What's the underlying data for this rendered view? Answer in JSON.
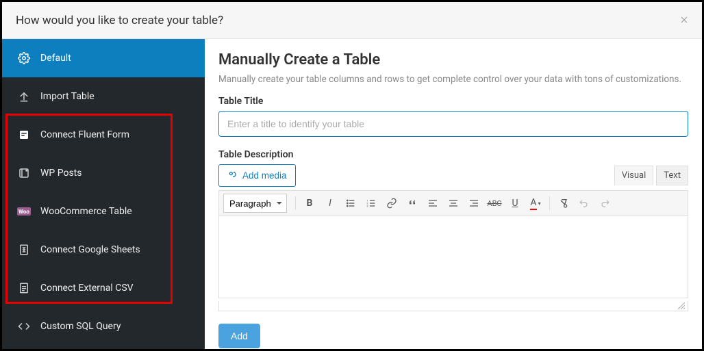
{
  "header": {
    "title": "How would you like to create your table?"
  },
  "sidebar": {
    "items": [
      {
        "label": "Default",
        "icon": "gear"
      },
      {
        "label": "Import Table",
        "icon": "upload"
      },
      {
        "label": "Connect Fluent Form",
        "icon": "form"
      },
      {
        "label": "WP Posts",
        "icon": "posts"
      },
      {
        "label": "WooCommerce Table",
        "icon": "woo"
      },
      {
        "label": "Connect Google Sheets",
        "icon": "sheet"
      },
      {
        "label": "Connect External CSV",
        "icon": "file"
      },
      {
        "label": "Custom SQL Query",
        "icon": "code"
      }
    ]
  },
  "main": {
    "heading": "Manually Create a Table",
    "subtitle": "Manually create your table columns and rows to get complete control over your data with tons of customizations.",
    "title_label": "Table Title",
    "title_placeholder": "Enter a title to identify your table",
    "desc_label": "Table Description",
    "add_media_label": "Add media",
    "tabs": {
      "visual": "Visual",
      "text": "Text"
    },
    "format_select": "Paragraph",
    "add_button": "Add"
  }
}
